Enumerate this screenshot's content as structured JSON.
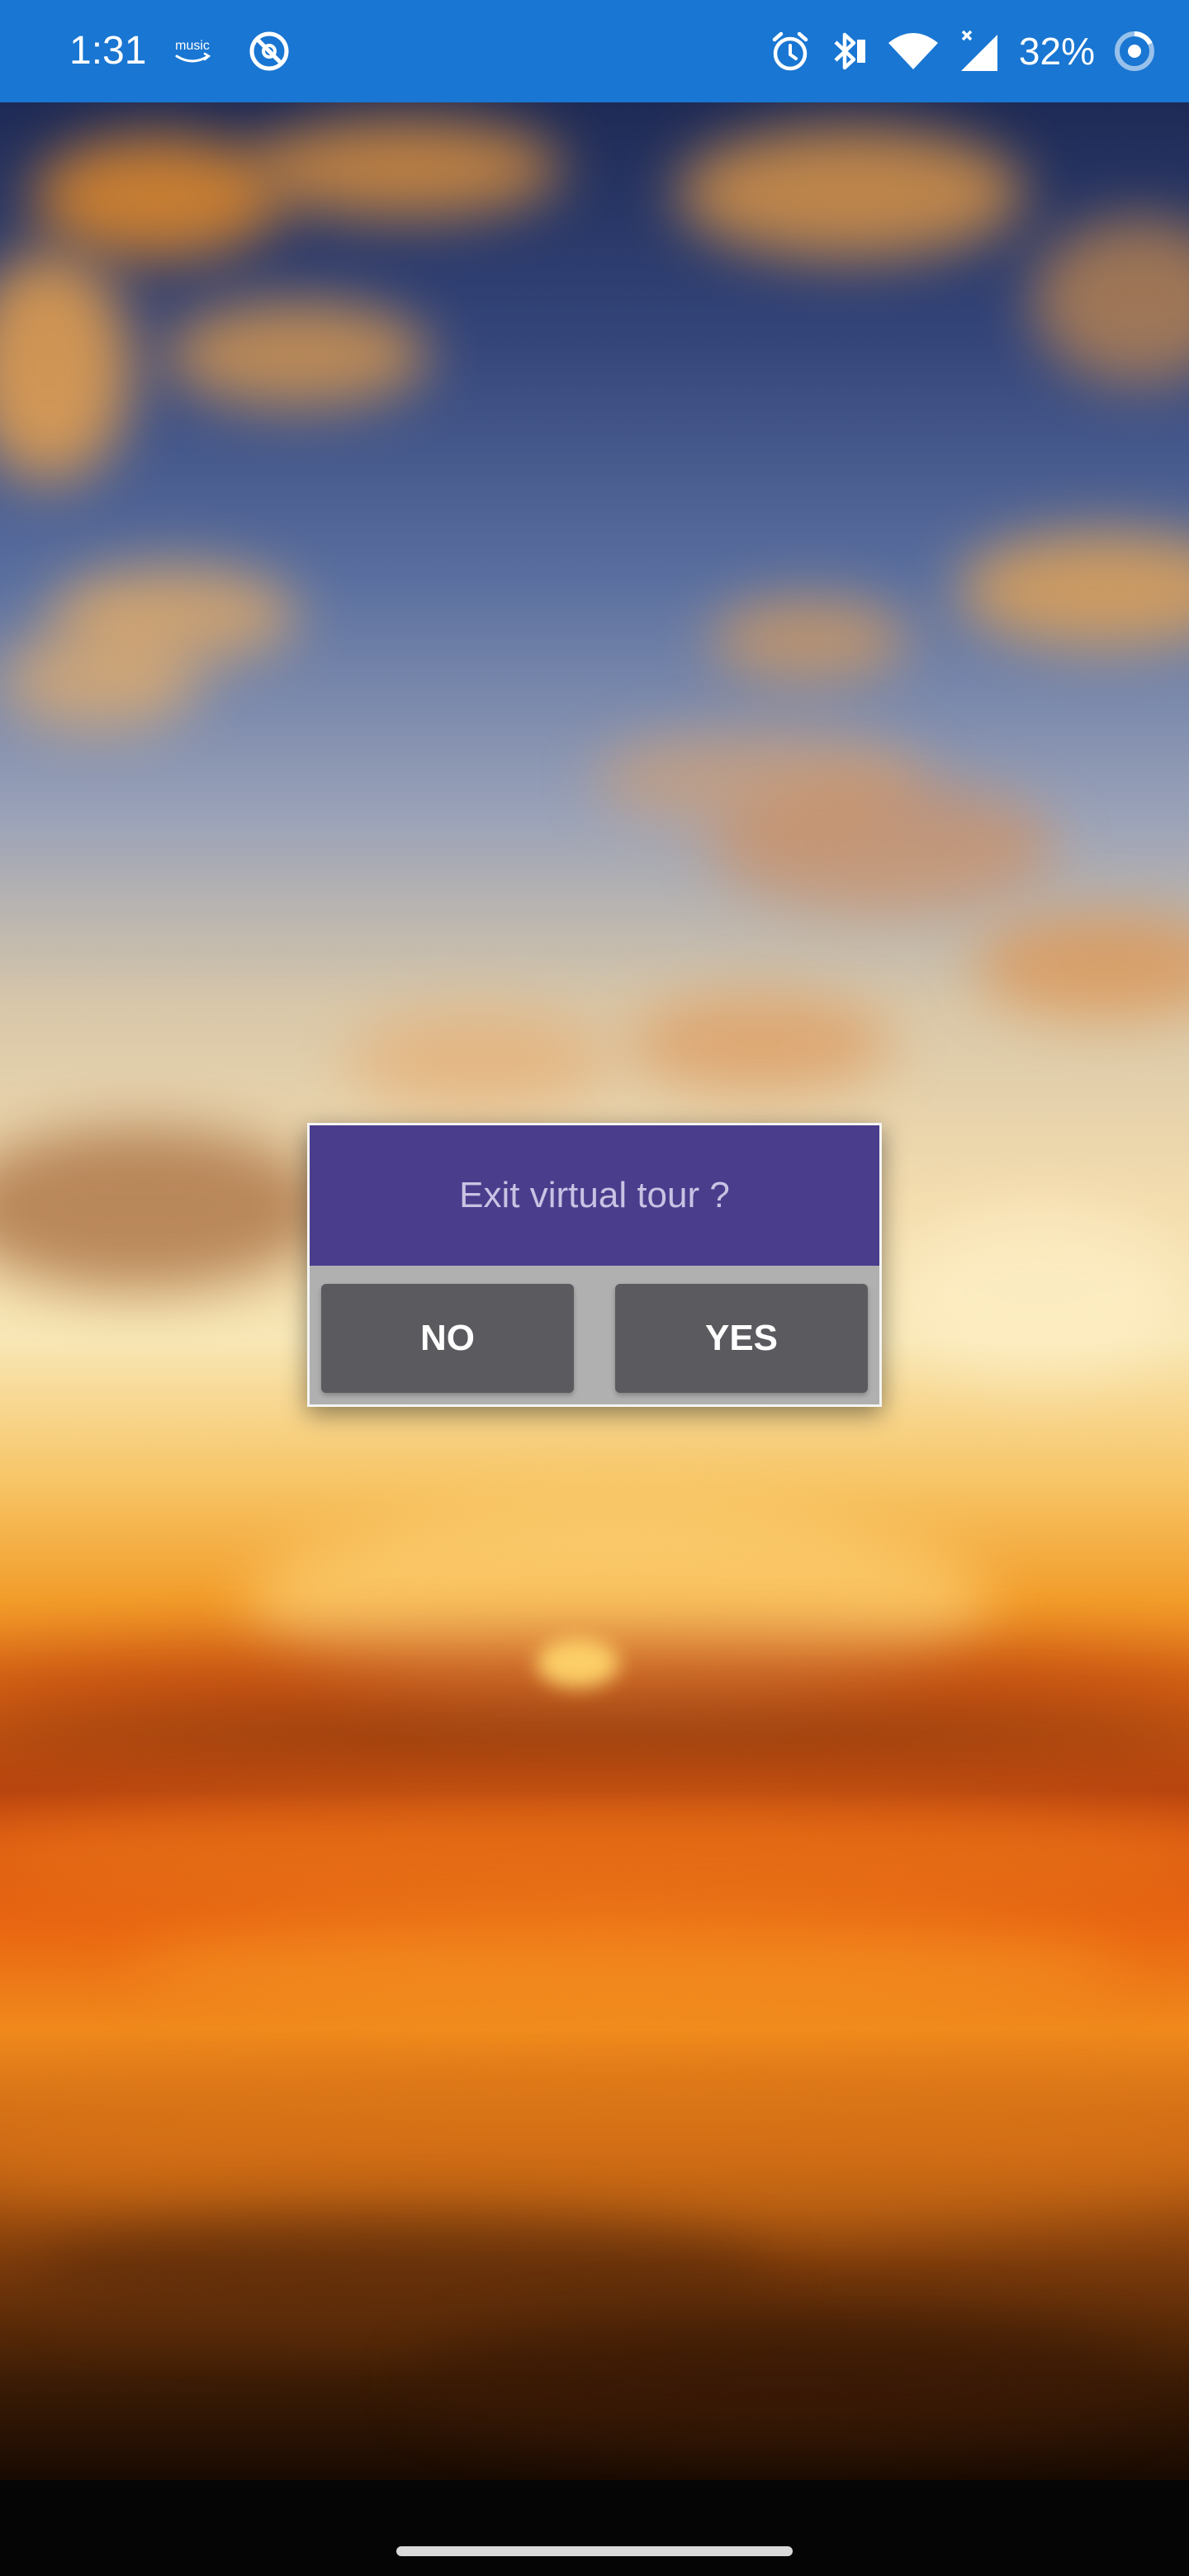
{
  "status_bar": {
    "time": "1:31",
    "battery_percent": "32%",
    "left_icons": [
      "amazon-music-icon",
      "blocked-icon"
    ],
    "right_icons": [
      "alarm-icon",
      "bluetooth-icon",
      "wifi-icon",
      "cellular-no-signal-icon",
      "battery-saver-icon"
    ],
    "amazon_music_label": "music",
    "background_color": "#1976d2"
  },
  "dialog": {
    "title": "Exit virtual tour ?",
    "no_label": "NO",
    "yes_label": "YES",
    "header_color": "#4a3d8c",
    "button_color": "#5b5b5f"
  },
  "background": {
    "description_icon": "sunset-background-image"
  },
  "navigation": {
    "gesture_handle_icon": "home-gesture-bar-icon"
  }
}
